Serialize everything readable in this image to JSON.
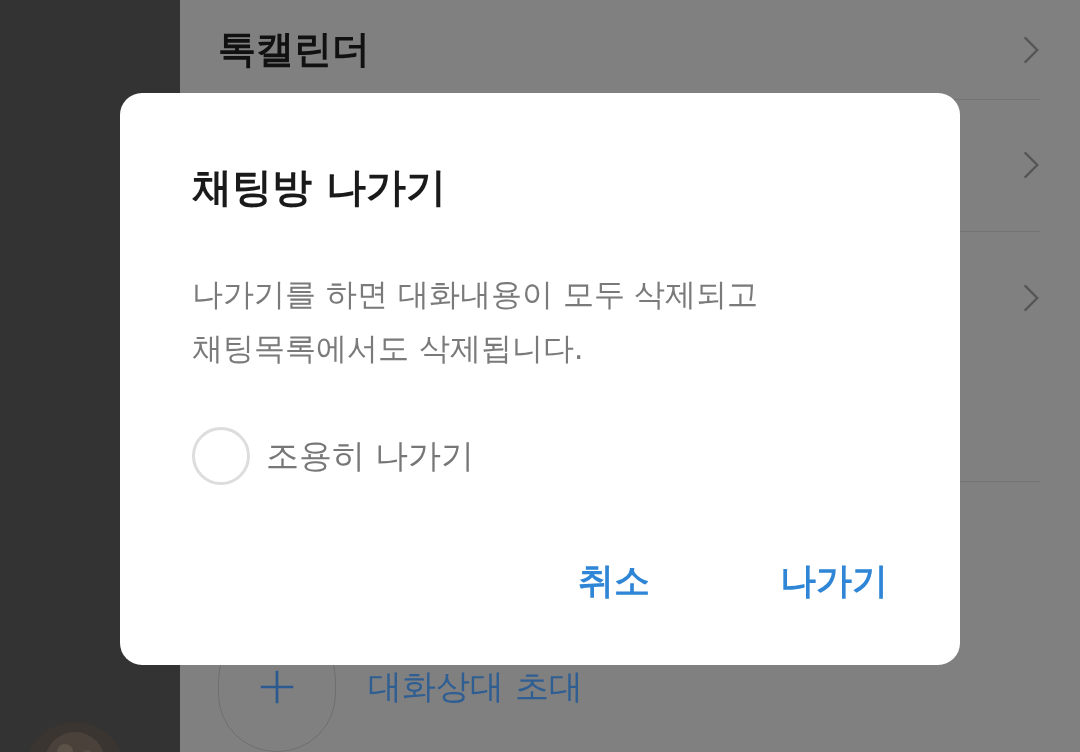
{
  "drawer": {
    "menu_items": [
      {
        "label": "톡캘린더"
      }
    ],
    "invite": {
      "label": "대화상대 초대"
    }
  },
  "dialog": {
    "title": "채팅방 나가기",
    "message": "나가기를 하면 대화내용이 모두 삭제되고\n채팅목록에서도 삭제됩니다.",
    "quiet_exit": {
      "label": "조용히 나가기",
      "checked": false
    },
    "buttons": [
      {
        "label": "취소"
      },
      {
        "label": "나가기"
      }
    ]
  }
}
